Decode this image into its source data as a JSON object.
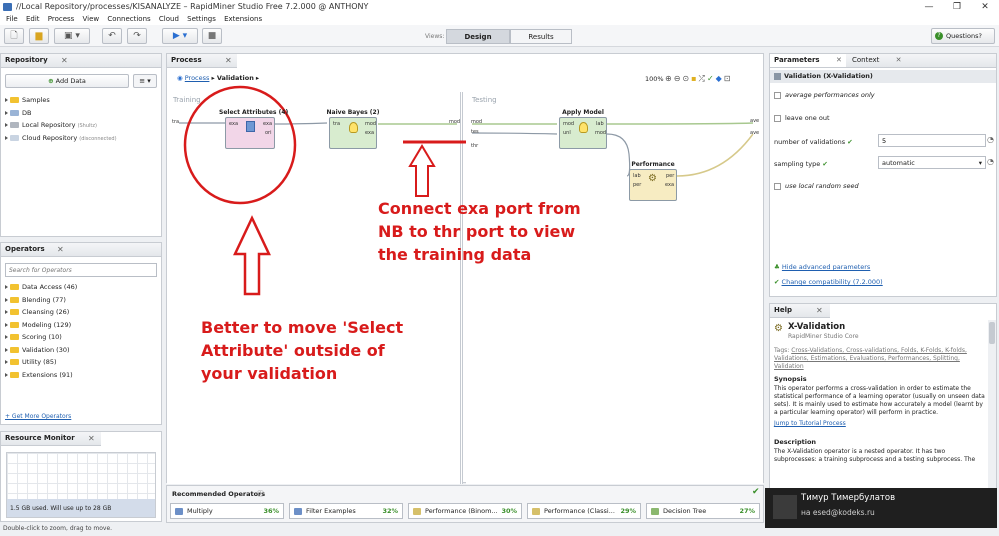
{
  "window": {
    "title": "//Local Repository/processes/KISANALYZE – RapidMiner Studio Free 7.2.000 @ ANTHONY",
    "min": "—",
    "max": "❐",
    "close": "✕"
  },
  "menu": [
    "File",
    "Edit",
    "Process",
    "View",
    "Connections",
    "Cloud",
    "Settings",
    "Extensions"
  ],
  "toolbar": {
    "views_label": "Views:",
    "design_tab": "Design",
    "results_tab": "Results",
    "questions": "Questions?"
  },
  "repository": {
    "title": "Repository",
    "add_data": "Add Data",
    "items": [
      {
        "label": "Samples",
        "sub": ""
      },
      {
        "label": "DB",
        "sub": ""
      },
      {
        "label": "Local Repository",
        "sub": "(Shultz)"
      },
      {
        "label": "Cloud Repository",
        "sub": "(disconnected)"
      }
    ]
  },
  "operators": {
    "title": "Operators",
    "search_placeholder": "Search for Operators",
    "items": [
      "Data Access (46)",
      "Blending (77)",
      "Cleansing (26)",
      "Modeling (129)",
      "Scoring (10)",
      "Validation (30)",
      "Utility (85)",
      "Extensions (91)"
    ],
    "get_more": "+ Get More Operators"
  },
  "resource_monitor": {
    "title": "Resource Monitor",
    "usage": "1.5 GB used. Will use up to 28 GB"
  },
  "status_bar": "Double-click to zoom, drag to move.",
  "process": {
    "title": "Process",
    "breadcrumb_root": "Process",
    "breadcrumb_current": "Validation",
    "zoom": "100%",
    "training_label": "Training",
    "testing_label": "Testing",
    "ports": {
      "tra": "tra",
      "mod": "mod",
      "tes": "tes",
      "thr": "thr",
      "ave1": "ave",
      "ave2": "ave"
    },
    "ops": {
      "select_attributes": {
        "title": "Select Attributes (4)",
        "in": "exa",
        "out1": "exa",
        "out2": "ori"
      },
      "naive_bayes": {
        "title": "Naive Bayes (2)",
        "in": "tra",
        "out1": "mod",
        "out2": "exa"
      },
      "apply_model": {
        "title": "Apply Model",
        "in1": "mod",
        "in2": "unl",
        "out1": "lab",
        "out2": "mod"
      },
      "performance": {
        "title": "Performance",
        "in1": "lab",
        "in2": "per",
        "out1": "per",
        "out2": "exa"
      }
    }
  },
  "annotations": {
    "right": [
      "Connect exa port from",
      "NB to thr port to view",
      "the training data"
    ],
    "left": [
      "Better to move 'Select",
      "Attribute' outside of",
      "your validation"
    ]
  },
  "recommended": {
    "title": "Recommended Operators",
    "items": [
      {
        "label": "Multiply",
        "pct": "36%"
      },
      {
        "label": "Filter Examples",
        "pct": "32%"
      },
      {
        "label": "Performance (Binom...",
        "pct": "30%"
      },
      {
        "label": "Performance (Classi...",
        "pct": "29%"
      },
      {
        "label": "Decision Tree",
        "pct": "27%"
      }
    ]
  },
  "parameters": {
    "tab1": "Parameters",
    "tab2": "Context",
    "operator_title": "Validation (X-Validation)",
    "average_performances_only": "average performances only",
    "leave_one_out": "leave one out",
    "number_of_validations_label": "number of validations",
    "number_of_validations_value": "5",
    "sampling_type_label": "sampling type",
    "sampling_type_value": "automatic",
    "use_local_random_seed": "use local random seed",
    "hide_advanced": "Hide advanced parameters",
    "change_compat": "Change compatibility (7.2.000)"
  },
  "help": {
    "title": "Help",
    "op_name": "X-Validation",
    "op_source": "RapidMiner Studio Core",
    "tags_label": "Tags:",
    "tags": "Cross-Validations, Cross-validations, Folds, K-Folds, K-folds, Validations, Estimations, Evaluations, Performances, Splitting, Validation",
    "synopsis_heading": "Synopsis",
    "synopsis": "This operator performs a cross-validation in order to estimate the statistical performance of a learning operator (usually on unseen data sets). It is mainly used to estimate how accurately a model (learnt by a particular learning operator) will perform in practice.",
    "jump": "Jump to Tutorial Process",
    "description_heading": "Description",
    "description": "The X-Validation operator is a nested operator. It has two subprocesses: a training subprocess and a testing subprocess. The"
  },
  "notification": {
    "name": "Тимур Тимербулатов",
    "sub": "на esed@kodeks.ru"
  },
  "colors": {
    "annotation_red": "#d81b1b",
    "select_attr_fill": "#f2d6e8",
    "model_fill": "#d8eccf",
    "perf_fill": "#f7ecc2",
    "link_blue": "#1f5fb0"
  }
}
